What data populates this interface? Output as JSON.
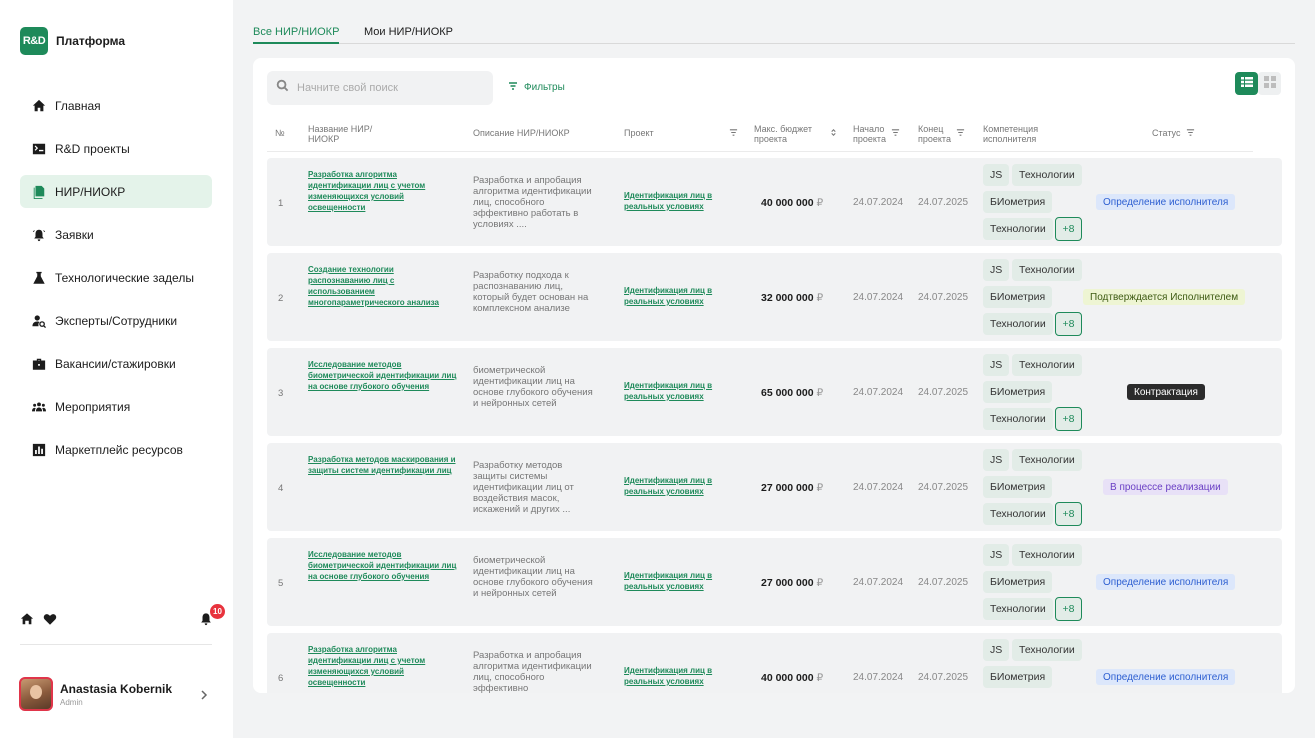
{
  "app": {
    "logo": "R&D",
    "name": "Платформа"
  },
  "nav": [
    {
      "label": "Главная",
      "icon": "home-icon"
    },
    {
      "label": "R&D проекты",
      "icon": "rd-projects-icon"
    },
    {
      "label": "НИР/НИОКР",
      "icon": "documents-icon",
      "active": true
    },
    {
      "label": "Заявки",
      "icon": "bell-ring-icon"
    },
    {
      "label": "Технологические заделы",
      "icon": "flask-icon"
    },
    {
      "label": "Эксперты/Сотрудники",
      "icon": "user-search-icon"
    },
    {
      "label": "Вакансии/стажировки",
      "icon": "briefcase-icon"
    },
    {
      "label": "Мероприятия",
      "icon": "people-group-icon"
    },
    {
      "label": "Маркетплейс ресурсов",
      "icon": "bar-chart-icon"
    }
  ],
  "notifications": {
    "count": "10"
  },
  "user": {
    "name": "Anastasia Kobernik",
    "role": "Admin"
  },
  "tabs": [
    {
      "label": "Все НИР/НИОКР",
      "active": true
    },
    {
      "label": "Мои НИР/НИОКР",
      "active": false
    }
  ],
  "toolbar": {
    "search_placeholder": "Начните свой поиск",
    "filters_label": "Фильтры"
  },
  "table": {
    "headers": {
      "num": "№",
      "name": "Название НИР/ НИОКР",
      "desc": "Описание НИР/НИОКР",
      "project": "Проект",
      "budget": "Макс. бюджет проекта",
      "start": "Начало проекта",
      "end": "Конец проекта",
      "competence": "Компетенция исполнителя",
      "status": "Статус"
    },
    "currency": "₽",
    "chips": {
      "js": "JS",
      "tech": "Технологии",
      "bio": "БИометрия",
      "more": "+8"
    },
    "rows": [
      {
        "num": "1",
        "name": "Разработка алгоритма идентификации лиц с учетом изменяющихся условий освещенности",
        "desc": "Разработка и апробация алгоритма идентификации лиц, способного эффективно работать в условиях ....",
        "project": "Идентификация лиц в реальных условиях",
        "budget": "40 000 000",
        "start": "24.07.2024",
        "end": "24.07.2025",
        "status": "Определение исполнителя",
        "status_style": "st-blue"
      },
      {
        "num": "2",
        "name": "Создание технологии распознаванию лиц с использованием многопараметрического анализа",
        "desc": "Разработку подхода к распознаванию лиц, который будет основан на комплексном анализе",
        "project": "Идентификация лиц в реальных условиях",
        "budget": "32 000 000",
        "start": "24.07.2024",
        "end": "24.07.2025",
        "status": "Подтверждается Исполнителем",
        "status_style": "st-yellow"
      },
      {
        "num": "3",
        "name": "Исследование методов биометрической идентификации лиц на основе глубокого обучения",
        "desc": "биометрической идентификации лиц на основе глубокого обучения и нейронных сетей",
        "project": "Идентификация лиц в реальных условиях",
        "budget": "65 000 000",
        "start": "24.07.2024",
        "end": "24.07.2025",
        "status": "Контрактация",
        "status_style": "st-dark"
      },
      {
        "num": "4",
        "name": "Разработка методов маскирования и защиты систем идентификации лиц",
        "desc": "Разработку методов защиты системы идентификации лиц от воздействия масок, искажений и других ...",
        "project": "Идентификация лиц в реальных условиях",
        "budget": "27 000 000",
        "start": "24.07.2024",
        "end": "24.07.2025",
        "status": "В процессе реализации",
        "status_style": "st-purple"
      },
      {
        "num": "5",
        "name": "Исследование методов биометрической идентификации лиц на основе глубокого обучения",
        "desc": "биометрической идентификации лиц на основе глубокого обучения и нейронных сетей",
        "project": "Идентификация лиц в реальных условиях",
        "budget": "27 000 000",
        "start": "24.07.2024",
        "end": "24.07.2025",
        "status": "Определение исполнителя",
        "status_style": "st-blue"
      },
      {
        "num": "6",
        "name": "Разработка алгоритма идентификации лиц с учетом изменяющихся условий освещенности",
        "desc": "Разработка и апробация алгоритма идентификации лиц, способного эффективно",
        "project": "Идентификация лиц в реальных условиях",
        "budget": "40 000 000",
        "start": "24.07.2024",
        "end": "24.07.2025",
        "status": "Определение исполнителя",
        "status_style": "st-blue"
      }
    ]
  }
}
